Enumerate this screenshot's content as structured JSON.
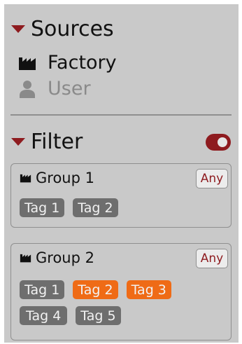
{
  "sources": {
    "title": "Sources",
    "items": [
      {
        "label": "Factory",
        "icon": "factory-icon",
        "active": true
      },
      {
        "label": "User",
        "icon": "user-icon",
        "active": false
      }
    ]
  },
  "filter": {
    "title": "Filter",
    "enabled": true,
    "groups": [
      {
        "title": "Group 1",
        "any_label": "Any",
        "tags": [
          {
            "label": "Tag 1",
            "selected": false
          },
          {
            "label": "Tag 2",
            "selected": false
          }
        ]
      },
      {
        "title": "Group 2",
        "any_label": "Any",
        "tags": [
          {
            "label": "Tag 1",
            "selected": false
          },
          {
            "label": "Tag 2",
            "selected": true
          },
          {
            "label": "Tag 3",
            "selected": true
          },
          {
            "label": "Tag 4",
            "selected": false
          },
          {
            "label": "Tag 5",
            "selected": false
          }
        ]
      }
    ]
  },
  "colors": {
    "accent": "#8e1b1f",
    "tag_selected": "#ef6b16",
    "tag_default": "#6e6e6e",
    "panel": "#c9c9c9"
  }
}
